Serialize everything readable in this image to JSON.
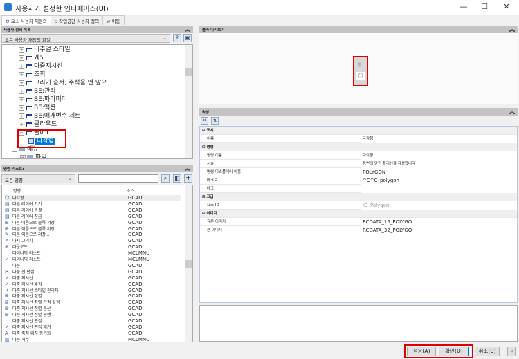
{
  "window": {
    "title": "사용자가 설정한 인터페이스(UI)",
    "minimize": "—",
    "maximize": "☐",
    "close": "✕"
  },
  "tabs": [
    {
      "label": "요소 사용자 재정의"
    },
    {
      "label": "작업공간 사용자 정의"
    },
    {
      "label": "이동"
    }
  ],
  "customize_list": {
    "header": "사용자 정의 목록",
    "file_select": "모든 사용자 재정의 파일",
    "tree": [
      {
        "label": "비주얼 스타일"
      },
      {
        "label": "궤도"
      },
      {
        "label": "다중지시선"
      },
      {
        "label": "조회"
      },
      {
        "label": "그리기 순서, 주석을 맨 앞으"
      },
      {
        "label": "BE:관리"
      },
      {
        "label": "BE:파라미터"
      },
      {
        "label": "BE:액션"
      },
      {
        "label": "BE:매개변수 세트"
      },
      {
        "label": "클라우드"
      },
      {
        "label": "툴바1"
      },
      {
        "label": "다각형"
      },
      {
        "label": "메뉴"
      },
      {
        "label": "파일"
      }
    ]
  },
  "command_list": {
    "header": "명령 리스트:",
    "filter": "모든 명령",
    "search_value": "",
    "columns": [
      "명령",
      "소스"
    ],
    "rows": [
      [
        "다각형",
        "GCAD"
      ],
      [
        "다른 레이어 끄기",
        "GCAD"
      ],
      [
        "다른 레이어 동결",
        "GCAD"
      ],
      [
        "다른 레이어 잠금",
        "GCAD"
      ],
      [
        "다른 이름으로 블록 저장",
        "GCAD"
      ],
      [
        "다른 이름으로 블록 저장",
        "GCAD"
      ],
      [
        "다른 이름으로 저장...",
        "GCAD"
      ],
      [
        "다시 그리기",
        "GCAD"
      ],
      [
        "다운로드",
        "GCAD"
      ],
      [
        "다이나믹 리스트",
        "MCLMNU"
      ],
      [
        "다이나믹 리스트",
        "MCLMNU"
      ],
      [
        "다중",
        "GCAD"
      ],
      [
        "다중 선 편집...",
        "GCAD"
      ],
      [
        "다중 지시선",
        "GCAD"
      ],
      [
        "다중 지시선 수집",
        "GCAD"
      ],
      [
        "다중 지시선 스타일 관리자",
        "GCAD"
      ],
      [
        "다중 지시선 정렬",
        "GCAD"
      ],
      [
        "다중 지시선 정렬 간격 설정",
        "GCAD"
      ],
      [
        "다중 지시선 정렬 분산",
        "GCAD"
      ],
      [
        "다중 지시선 정렬 평행",
        "GCAD"
      ],
      [
        "다중 지시선 편집",
        "GCAD"
      ],
      [
        "다중 지시선 편집 제거",
        "GCAD"
      ],
      [
        "다중 축척 위치 동기화",
        "GCAD"
      ],
      [
        "다중 치수",
        "MCLMNU"
      ]
    ]
  },
  "preview": {
    "header": "툴바 미리보기",
    "grip": "툴"
  },
  "properties": {
    "header": "속성",
    "rows": [
      {
        "cat": "표시"
      },
      {
        "k": "이름",
        "v": "다각형"
      },
      {
        "cat": "명령"
      },
      {
        "k": "명령 이름",
        "v": "다각형"
      },
      {
        "k": "서술",
        "v": "등변의 닫힌 폴리선을 작성합니다"
      },
      {
        "k": "명령 디스플레이 이름",
        "v": "POLYGON"
      },
      {
        "k": "매크로",
        "v": "^C^C_polygon"
      },
      {
        "k": "태그",
        "v": ""
      },
      {
        "cat": "고급"
      },
      {
        "k": "요소 ID",
        "v": "ID_Polygon"
      },
      {
        "cat": "이미지"
      },
      {
        "k": "작은 이미지",
        "v": "RCDATA_16_POLYGO"
      },
      {
        "k": "큰 이미지",
        "v": "RCDATA_32_POLYGO"
      }
    ]
  },
  "buttons": {
    "apply": "적용(A)",
    "ok": "확인(O)",
    "cancel": "취소(C)",
    "collapse": "«"
  }
}
